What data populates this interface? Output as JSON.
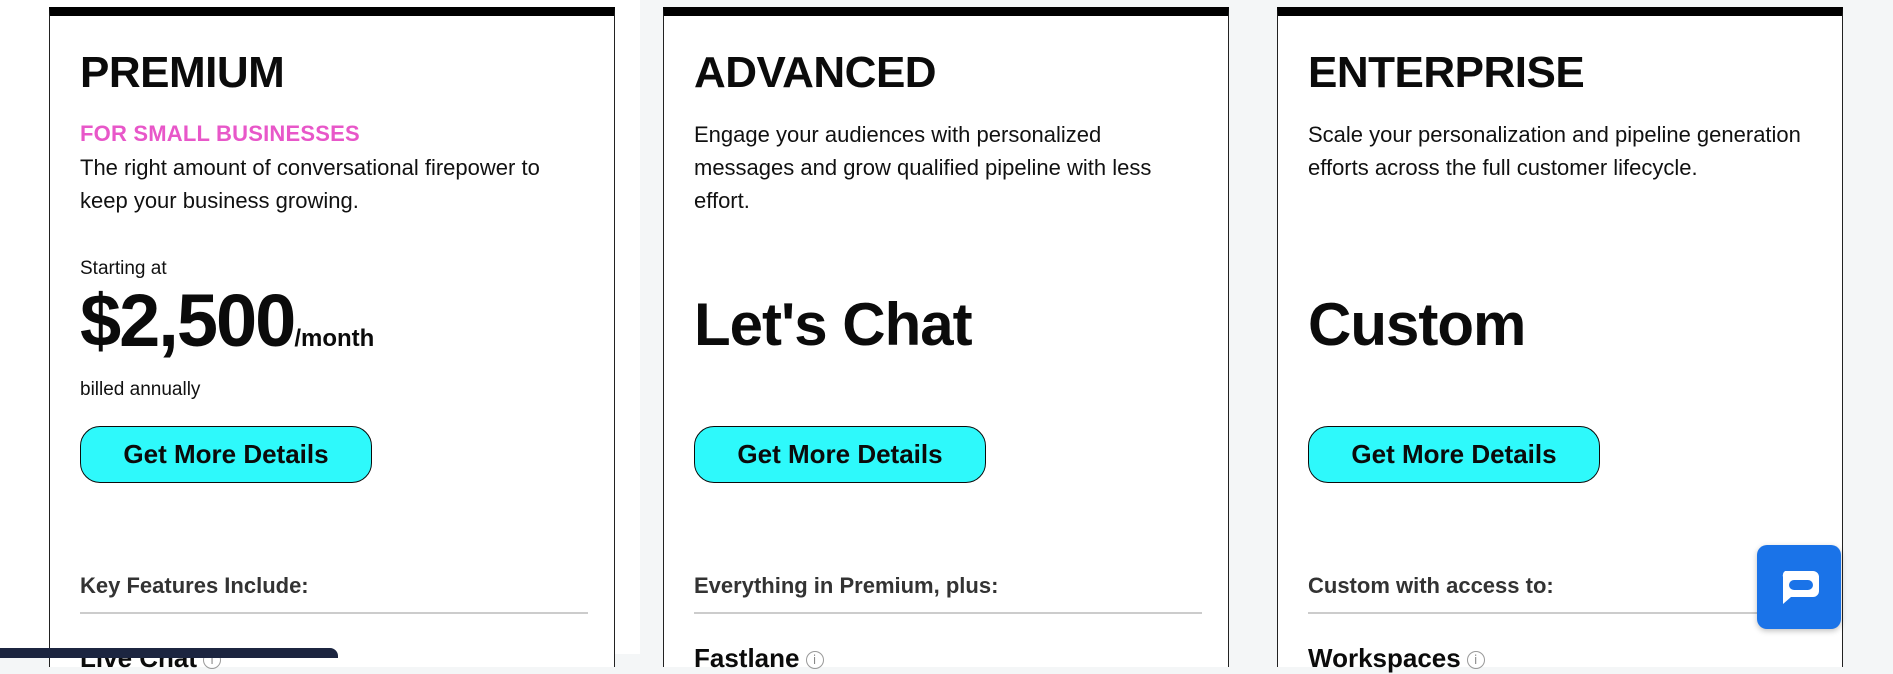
{
  "plans": [
    {
      "title": "PREMIUM",
      "tag": "FOR SMALL BUSINESSES",
      "description": "The right amount of conversational firepower to keep your business growing.",
      "starting_label": "Starting at",
      "price": "$2,500",
      "price_unit": "/month",
      "billing": "billed annually",
      "cta": "Get More Details",
      "section_heading": "Key Features Include:",
      "first_feature": "Live Chat"
    },
    {
      "title": "ADVANCED",
      "description": "Engage your audiences with personalized messages and grow qualified pipeline with less effort.",
      "price_text": "Let's Chat",
      "cta": "Get More Details",
      "section_heading": "Everything in Premium, plus:",
      "first_feature": "Fastlane"
    },
    {
      "title": "ENTERPRISE",
      "description": "Scale your personalization and pipeline generation efforts across the full customer lifecycle.",
      "price_text": "Custom",
      "cta": "Get More Details",
      "section_heading": "Custom with access to:",
      "first_feature": "Workspaces"
    }
  ],
  "info_glyph": "i",
  "colors": {
    "accent_cyan": "#2ef9fb",
    "tag_pink": "#e857c9",
    "chat_button_blue": "#1a73e8"
  },
  "icons": {
    "info": "info-circle-icon",
    "chat": "chat-bubble-icon"
  }
}
